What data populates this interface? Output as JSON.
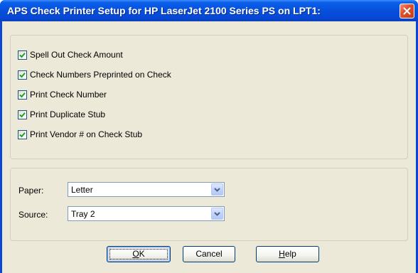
{
  "window": {
    "title": "APS Check Printer Setup for HP LaserJet 2100 Series PS on LPT1:"
  },
  "options": [
    {
      "label": "Spell Out Check Amount",
      "checked": true
    },
    {
      "label": "Check Numbers Preprinted on Check",
      "checked": true
    },
    {
      "label": "Print Check Number",
      "checked": true
    },
    {
      "label": "Print Duplicate Stub",
      "checked": true
    },
    {
      "label": "Print Vendor # on Check Stub",
      "checked": true
    }
  ],
  "paper": {
    "label": "Paper:",
    "value": "Letter"
  },
  "source": {
    "label": "Source:",
    "value": "Tray 2"
  },
  "buttons": {
    "ok": {
      "label": "OK",
      "underline": "O"
    },
    "cancel": {
      "label": "Cancel"
    },
    "help": {
      "label": "Help",
      "underline": "H"
    }
  },
  "colors": {
    "titlebar": "#0650dc",
    "dialog_bg": "#ece9d8",
    "checkmark": "#21a121",
    "close_button": "#e0522e"
  },
  "icons": {
    "close": "close-icon",
    "checkmark": "checkmark-icon",
    "dropdown": "chevron-down-icon"
  }
}
